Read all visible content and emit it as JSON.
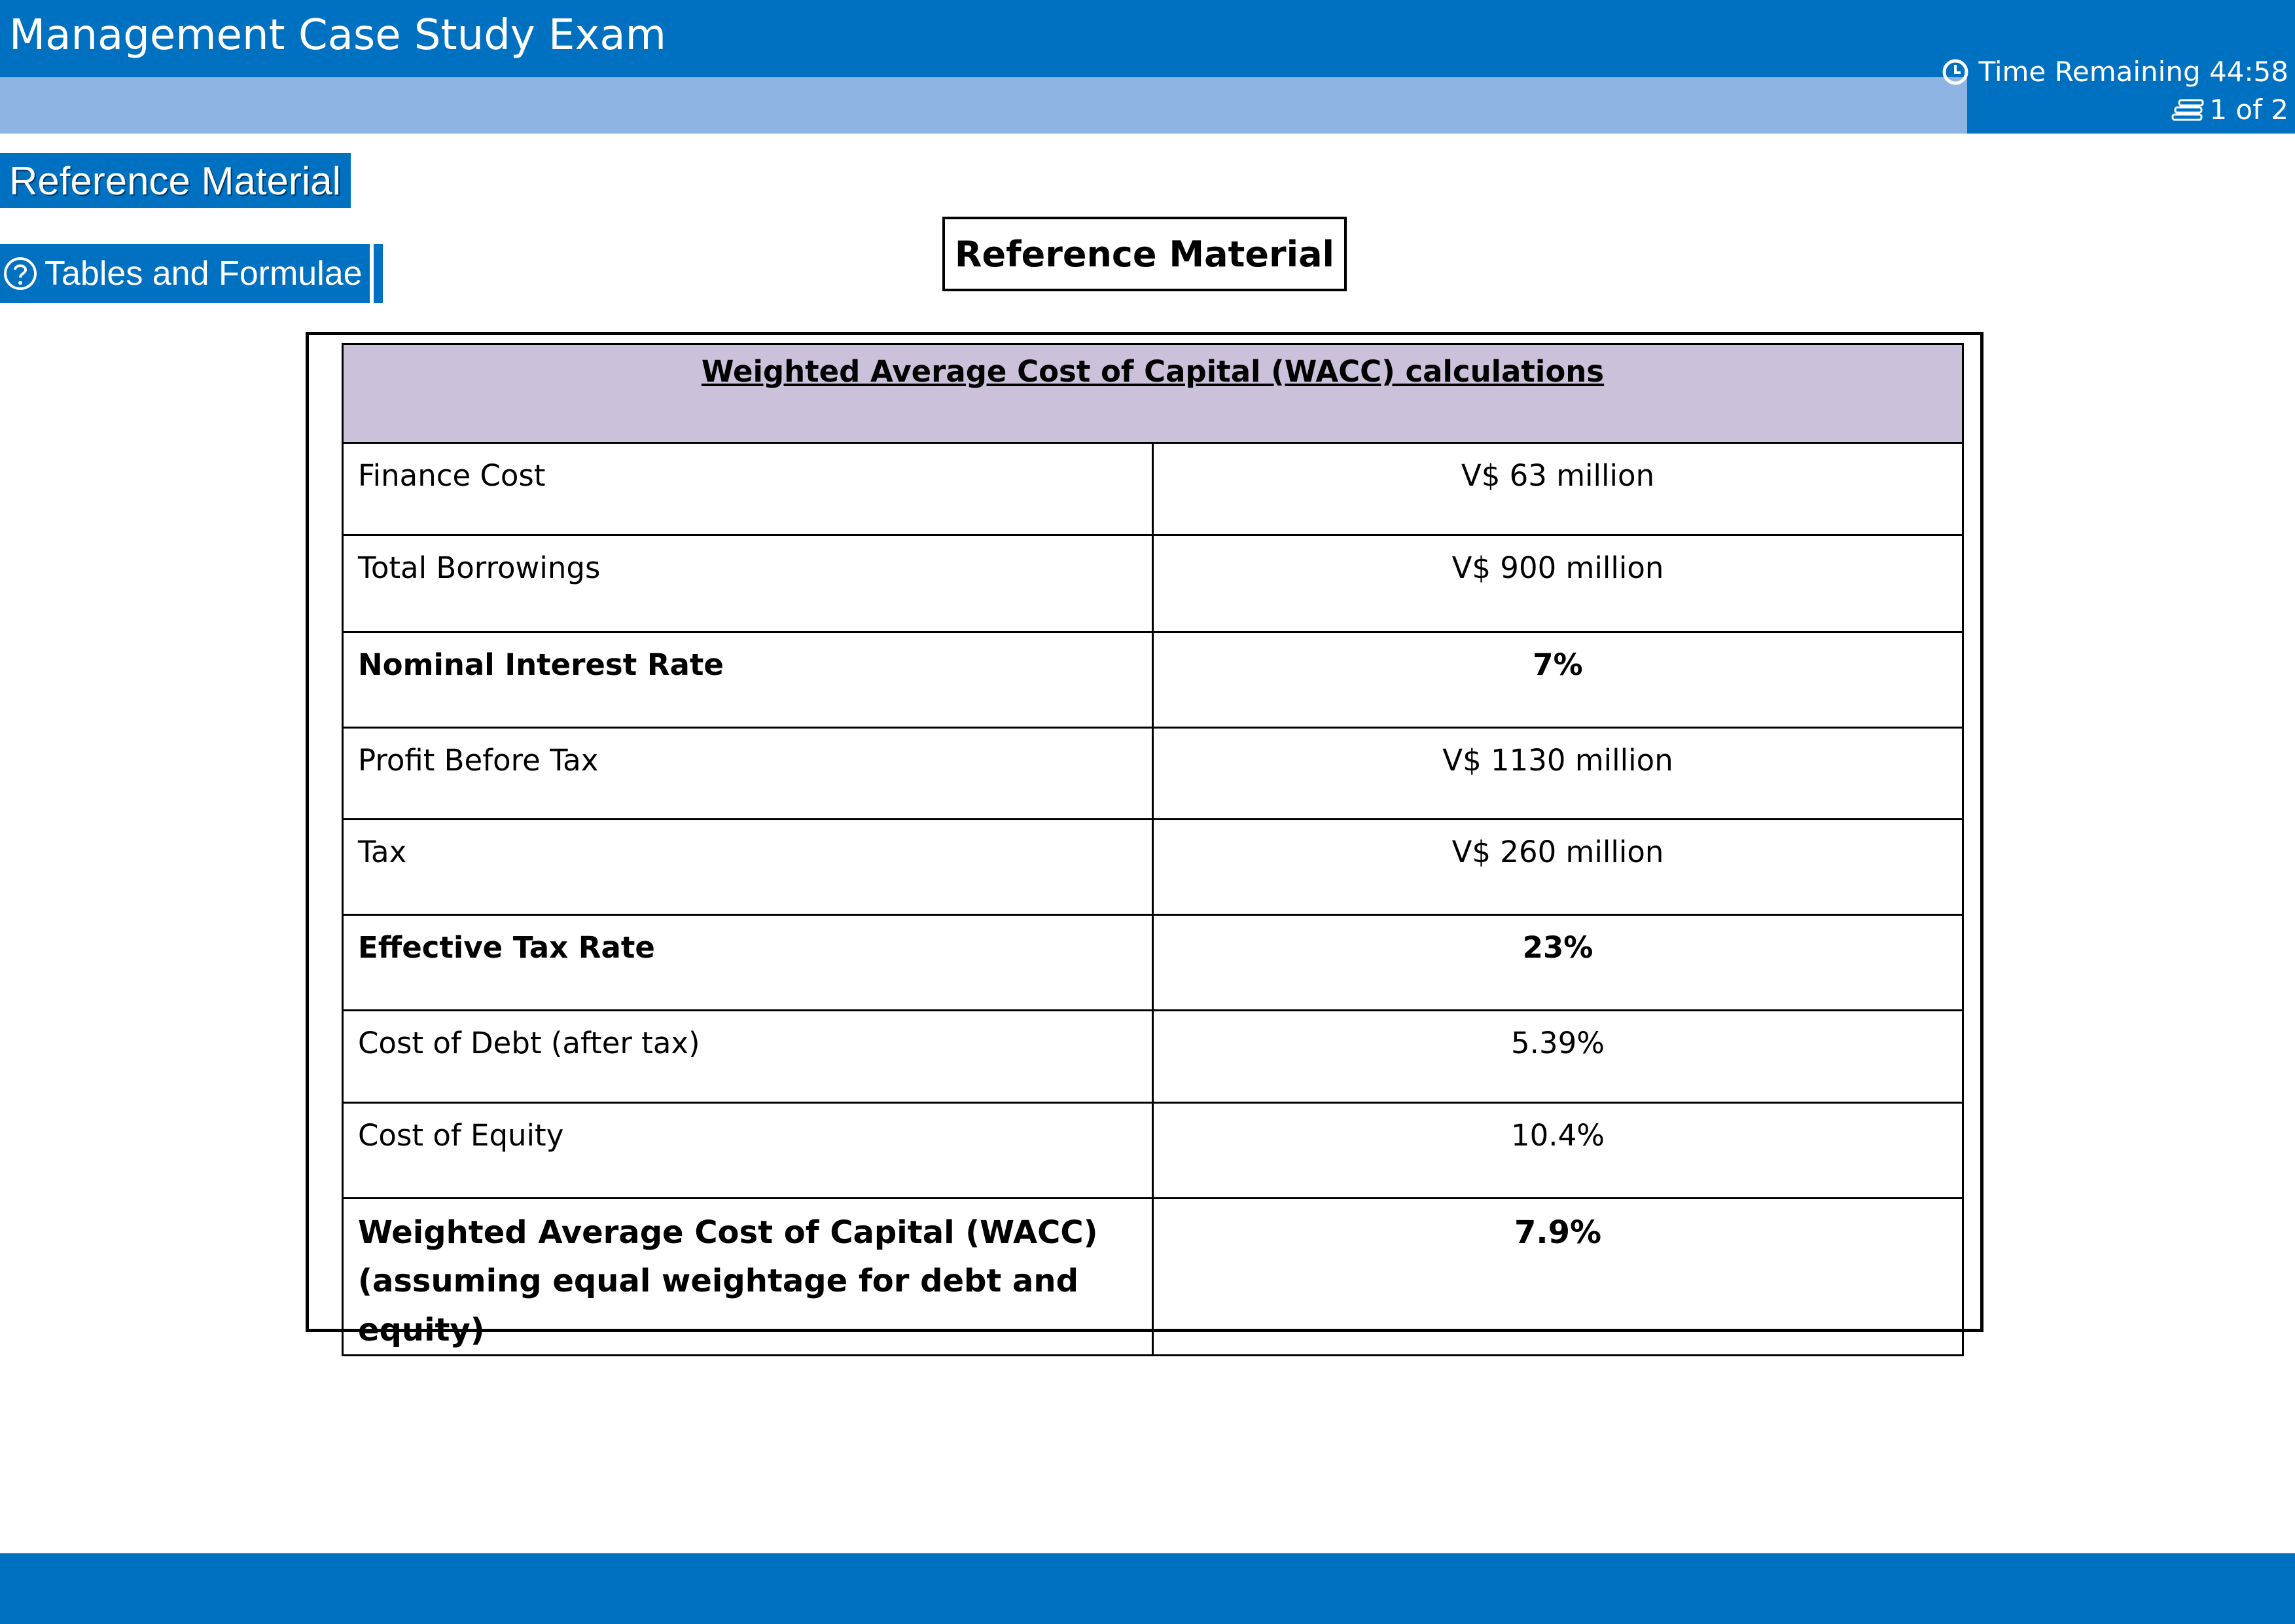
{
  "header": {
    "title": "Management Case Study Exam",
    "time_remaining": "Time Remaining 44:58",
    "page_indicator": "1 of 2"
  },
  "sidebar": {
    "reference_tab": "Reference Material",
    "tables_button": "Tables and Formulae"
  },
  "main": {
    "heading": "Reference Material",
    "table": {
      "title": "Weighted Average Cost of Capital (WACC) calculations",
      "rows": [
        {
          "label": "Finance Cost",
          "value": "V$ 63 million"
        },
        {
          "label": "Total Borrowings",
          "value": "V$ 900 million"
        },
        {
          "label": "Nominal Interest Rate",
          "value": "7%"
        },
        {
          "label": "Profit Before Tax",
          "value": "V$ 1130 million"
        },
        {
          "label": "Tax",
          "value": "V$ 260 million"
        },
        {
          "label": "Effective Tax Rate",
          "value": "23%"
        },
        {
          "label": "Cost of Debt (after tax)",
          "value": "5.39%"
        },
        {
          "label": "Cost of Equity",
          "value": "10.4%"
        },
        {
          "label": "Weighted Average Cost of Capital (WACC)",
          "label_line2": "(assuming equal weightage for debt and equity)",
          "value": "7.9%"
        }
      ]
    }
  },
  "colors": {
    "primary_blue": "#0070c0",
    "light_blue": "#8db4e2",
    "table_header": "#ccc1da"
  },
  "icons": {
    "timer": "clock-icon",
    "pages": "pages-icon",
    "help": "help-circle-icon"
  }
}
